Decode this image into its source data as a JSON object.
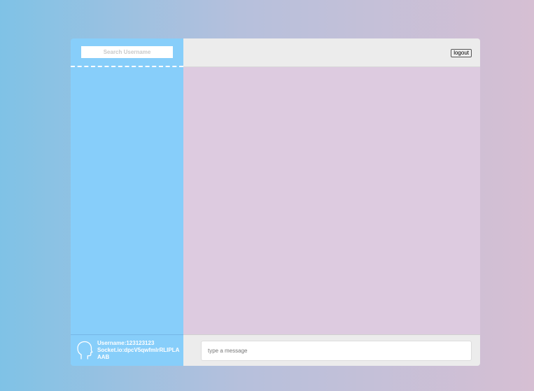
{
  "search": {
    "placeholder": "Search Username"
  },
  "header": {
    "logout_label": "logout"
  },
  "profile": {
    "username": "Username:123123123",
    "socket": "Socket.io:dpcV5qwfmlrRLIPLAAAB",
    "avatar_icon": "head-silhouette-icon"
  },
  "composer": {
    "placeholder": "type a message"
  },
  "colors": {
    "sidebar": "#87cefa",
    "chat_background": "#ddcbe0",
    "header": "#ececec"
  }
}
